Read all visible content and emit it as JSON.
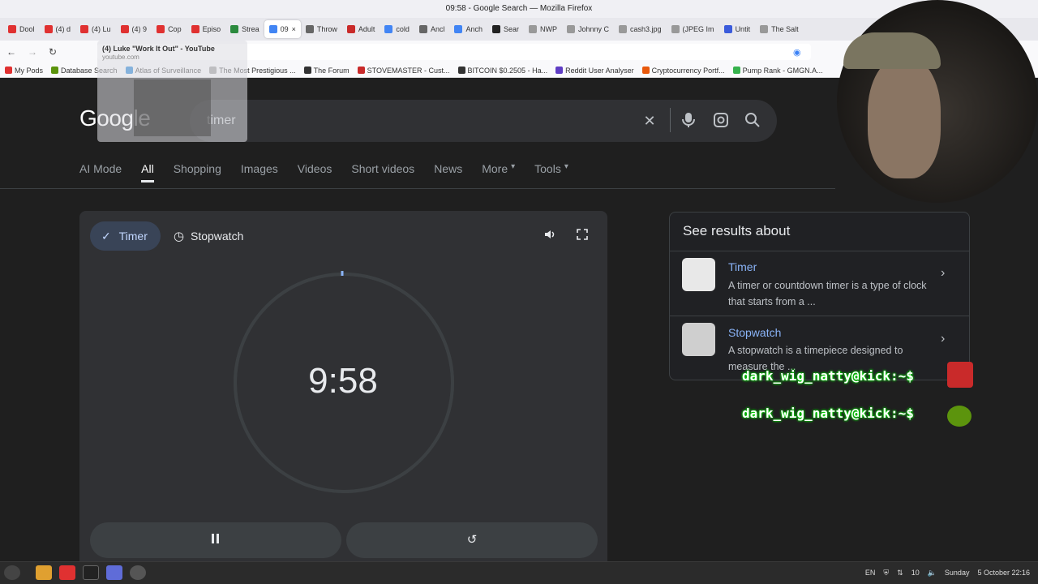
{
  "window": {
    "title": "09:58 - Google Search — Mozilla Firefox"
  },
  "tabs": [
    {
      "label": "Dool",
      "color": "#e03131"
    },
    {
      "label": "(4) d",
      "color": "#e03131"
    },
    {
      "label": "(4) Lu",
      "color": "#e03131"
    },
    {
      "label": "(4) 9",
      "color": "#e03131"
    },
    {
      "label": "Cop",
      "color": "#e03131"
    },
    {
      "label": "Episo",
      "color": "#e03131"
    },
    {
      "label": "Strea",
      "color": "#2b8a3e"
    },
    {
      "label": "09",
      "color": "#4285f4"
    },
    {
      "label": "Throw",
      "color": "#666666"
    },
    {
      "label": "Adult",
      "color": "#c92a2a"
    },
    {
      "label": "cold",
      "color": "#4285f4"
    },
    {
      "label": "Ancl",
      "color": "#666666"
    },
    {
      "label": "Anch",
      "color": "#4285f4"
    },
    {
      "label": "Sear",
      "color": "#222222"
    },
    {
      "label": "NWP",
      "color": "#999999"
    },
    {
      "label": "Johnny C",
      "color": "#999999"
    },
    {
      "label": "cash3.jpg",
      "color": "#999999"
    },
    {
      "label": "(JPEG Im",
      "color": "#999999"
    },
    {
      "label": "Untit",
      "color": "#3b5bdb"
    },
    {
      "label": "The Salt",
      "color": "#999999"
    }
  ],
  "tooltip": {
    "title": "(4) Luke \"Work It Out\" - YouTube",
    "subtitle": "youtube.com",
    "search_hint": "timer"
  },
  "bookmarks": [
    {
      "label": "My Pods",
      "color": "#e03131"
    },
    {
      "label": "Database Search",
      "color": "#5c940d"
    },
    {
      "label": "Atlas of Surveillance",
      "color": "#1c7ed6"
    },
    {
      "label": "The Most Prestigious ...",
      "color": "#999999"
    },
    {
      "label": "The Forum",
      "color": "#333333"
    },
    {
      "label": "STOVEMASTER - Cust...",
      "color": "#c92a2a"
    },
    {
      "label": "BITCOIN $0.2505 - Ha...",
      "color": "#333333"
    },
    {
      "label": "Reddit User Analyser",
      "color": "#5f3dc4"
    },
    {
      "label": "Cryptocurrency Portf...",
      "color": "#e8590c"
    },
    {
      "label": "Pump Rank - GMGN.A...",
      "color": "#37b24d"
    }
  ],
  "google": {
    "logo": "Google",
    "query": "timer",
    "nav": [
      "AI Mode",
      "All",
      "Shopping",
      "Images",
      "Videos",
      "Short videos",
      "News",
      "More",
      "Tools"
    ],
    "nav_active": "All"
  },
  "timer": {
    "tab_timer": "Timer",
    "tab_stopwatch": "Stopwatch",
    "time": "9:58",
    "remaining_fraction": 0.997
  },
  "about": {
    "title": "See results about",
    "results": [
      {
        "title": "Timer",
        "desc": "A timer or countdown timer is a type of clock that starts from a ..."
      },
      {
        "title": "Stopwatch",
        "desc": "A stopwatch is a timepiece designed to measure the ..."
      }
    ]
  },
  "overlay": {
    "prompt1": "dark_wig_natty@kick:~$",
    "prompt2": "dark_wig_natty@kick:~$"
  },
  "tray": {
    "lang": "EN",
    "volume": "10",
    "day": "Sunday",
    "date": "5 October 22:16"
  }
}
